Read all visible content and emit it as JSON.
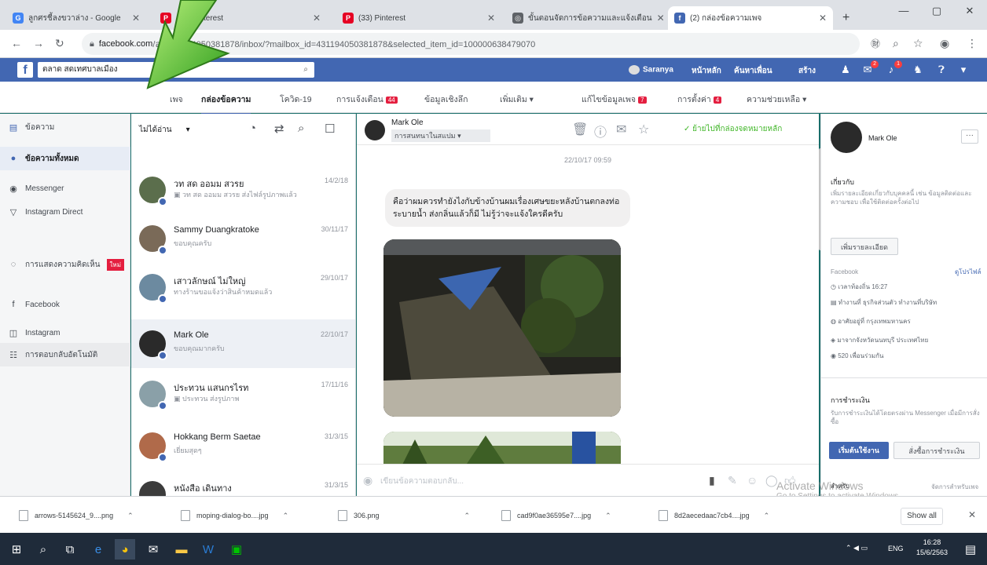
{
  "browser": {
    "tabs": [
      {
        "title": "ลูกศรชี้ลงขวาล่าง - Google",
        "favicon": "G",
        "color": "#4285f4"
      },
      {
        "title": "(33) Pinterest",
        "favicon": "P",
        "color": "#e60023"
      },
      {
        "title": "(33) Pinterest",
        "favicon": "P",
        "color": "#e60023"
      },
      {
        "title": "ขั้นตอนจัดการข้อความและแจ้งเตือน",
        "favicon": "◎",
        "color": "#5f6368"
      },
      {
        "title": "(2) กล่องข้อความเพจ",
        "favicon": "f",
        "color": "#4267b2"
      }
    ],
    "new_tab": "+",
    "url_host": "facebook.com",
    "url_path": "/ละ-431194050381878/inbox/?mailbox_id=431194050381878&selected_item_id=100000638479070"
  },
  "fb": {
    "search_value": "ตลาด สดเทศบาลเมือง",
    "user": "Saranya",
    "nav": [
      "หน้าหลัก",
      "ค้นหาเพื่อน",
      "สร้าง"
    ],
    "badge_a": "2",
    "badge_b": "1"
  },
  "page_tabs": [
    {
      "label": "เพจ",
      "active": false
    },
    {
      "label": "กล่องข้อความ",
      "active": true
    },
    {
      "label": "โควิด-19",
      "active": false
    },
    {
      "label": "การแจ้งเตือน",
      "active": false,
      "badge": "44"
    },
    {
      "label": "ข้อมูลเชิงลึก",
      "active": false
    },
    {
      "label": "เพิ่มเติม ▾",
      "active": false
    },
    {
      "label": "แก้ไขข้อมูลเพจ",
      "active": false,
      "badge": "7"
    },
    {
      "label": "การตั้งค่า",
      "active": false,
      "badge": "4"
    },
    {
      "label": "ความช่วยเหลือ ▾",
      "active": false
    }
  ],
  "left_nav": [
    {
      "label": "ข้อความ",
      "icon": "inbox-icon",
      "glyph": "▤",
      "selected": false,
      "tag": ""
    },
    {
      "label": "ข้อความทั้งหมด",
      "icon": "messages-icon",
      "glyph": "●",
      "selected": true,
      "tag": ""
    },
    {
      "label": "Messenger",
      "icon": "messenger-icon",
      "glyph": "◉",
      "selected": false,
      "tag": ""
    },
    {
      "label": "Instagram Direct",
      "icon": "filter-icon",
      "glyph": "▽",
      "selected": false,
      "tag": ""
    },
    {
      "label": "การแสดงความคิดเห็น",
      "icon": "comment-icon",
      "glyph": "◌",
      "selected": false,
      "tag": "ใหม่"
    },
    {
      "label": "Facebook",
      "icon": "facebook-icon",
      "glyph": "f",
      "selected": false,
      "tag": ""
    },
    {
      "label": "Instagram",
      "icon": "instagram-icon",
      "glyph": "◫",
      "selected": false,
      "tag": ""
    },
    {
      "label": "การตอบกลับอัตโนมัติ",
      "icon": "auto-reply-icon",
      "glyph": "☷",
      "selected": false,
      "tag": ""
    }
  ],
  "conv_list": {
    "filter_label": "ไม่ได้อ่าน",
    "items": [
      {
        "name": "วท สด ออมม สวรย",
        "snippet": "▣ วท สด ออมม สวรย ส่งไฟล์รูปภาพแล้ว",
        "date": "14/2/18",
        "avatar": "#5b6e4c",
        "selected": false
      },
      {
        "name": "Sammy Duangkratoke",
        "snippet": "ขอบคุณครับ",
        "date": "30/11/17",
        "avatar": "#7a6a58",
        "selected": false
      },
      {
        "name": "เสาวลักษณ์ ไม่ใหญ่",
        "snippet": "ทางร้านขอแจ้งว่าสินค้าหมดแล้ว",
        "date": "29/10/17",
        "avatar": "#6c8aa0",
        "selected": false
      },
      {
        "name": "Mark Ole",
        "snippet": "ขอบคุณมากครับ",
        "date": "22/10/17",
        "avatar": "#2a2a2a",
        "selected": true
      },
      {
        "name": "ประทวน แสนกรไรท",
        "snippet": "▣ ประทวน ส่งรูปภาพ",
        "date": "17/11/16",
        "avatar": "#8aa0a8",
        "selected": false
      },
      {
        "name": "Hokkang Berm Saetae",
        "snippet": "เยี่ยมสุดๆ",
        "date": "31/3/15",
        "avatar": "#b06a4a",
        "selected": false
      },
      {
        "name": "หนังสือ เดินทาง",
        "snippet": "",
        "date": "31/3/15",
        "avatar": "#3c3c3c",
        "selected": false
      }
    ]
  },
  "thread": {
    "name": "Mark Ole",
    "status": "การสนทนาในสแปม ▾",
    "move_label": "✓ ย้ายไปที่กล่องจดหมายหลัก",
    "timestamp": "22/10/17 09:59",
    "message": "คือว่าผมควรทำยังไงกับข้างบ้านผมเรื่องเศษขยะหลังบ้านตกลงท่อระบายน้ำ ส่งกลิ่นแล้วก็มี ไม่รู้ว่าจะแจ้งใครดีครับ",
    "composer_placeholder": "เขียนข้อความตอบกลับ..."
  },
  "right_panel": {
    "name": "Mark Ole",
    "section1_title": "เกี่ยวกับ",
    "section1_text": "เพิ่มรายละเอียดเกี่ยวกับบุคคลนี้ เช่น ข้อมูลติดต่อและความชอบ เพื่อใช้ติดต่อครั้งต่อไป",
    "add_button": "เพิ่มรายละเอียด",
    "fb_label": "Facebook",
    "fb_link": "ดูโปรไฟล์",
    "facts": [
      "◷ เวลาท้องถิ่น 16:27",
      "▤ ทำงานที่ ธุรกิจส่วนตัว ทำงานที่บริษัท",
      "◍ อาศัยอยู่ที่ กรุงเทพมหานคร",
      "◈ มาจากจังหวัดนนทบุรี ประเทศไทย",
      "◉ 520 เพื่อนร่วมกัน"
    ],
    "section2_title": "การชำระเงิน",
    "section2_text": "รับการชำระเงินได้โดยตรงผ่าน Messenger เมื่อมีการสั่งซื้อ",
    "btn_primary": "เริ่มต้นใช้งาน",
    "btn_secondary": "สั่งซื้อการชำระเงิน",
    "bottom_left": "สำหรับ",
    "bottom_right": "จัดการสำหรับเพจ"
  },
  "downloads": [
    {
      "name": "arrows-5145624_9....png"
    },
    {
      "name": "moping-dialog-bo....jpg"
    },
    {
      "name": "306.png"
    },
    {
      "name": "cad9f0ae36595e7....jpg"
    },
    {
      "name": "8d2aecedaac7cb4....jpg"
    }
  ],
  "downloads_showall": "Show all",
  "taskbar": {
    "lang": "ENG",
    "time": "16:28",
    "date": "15/6/2563"
  },
  "watermark": {
    "line1": "Activate Windows",
    "line2": "Go to Settings to activate Windows."
  }
}
